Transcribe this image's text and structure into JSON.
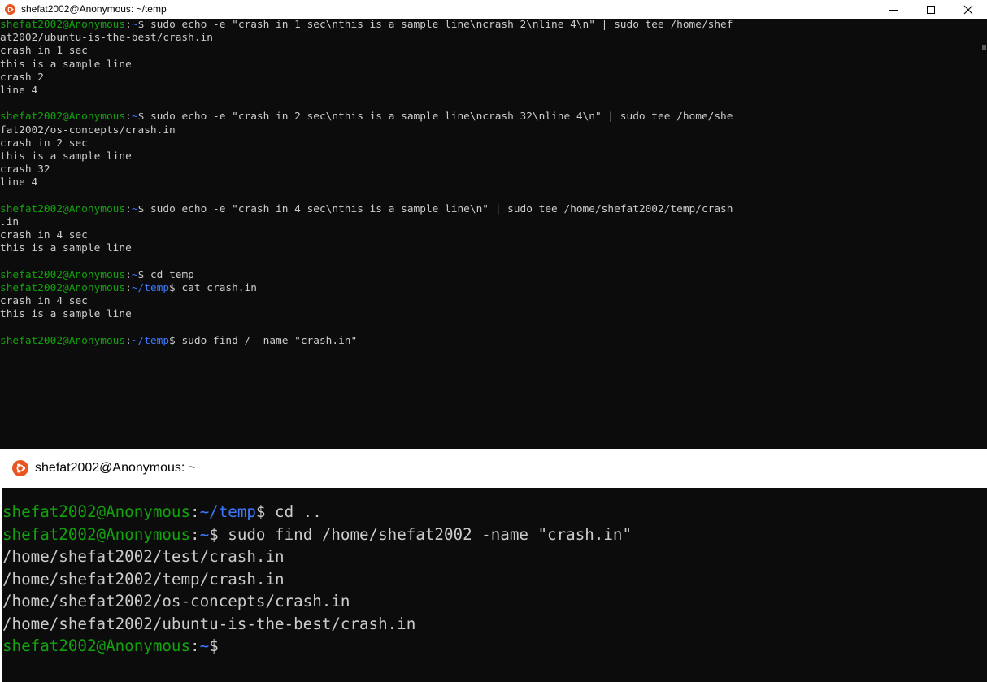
{
  "colors": {
    "background": "#0c0c0c",
    "text": "#cccccc",
    "user": "#13a10e",
    "path": "#3b78ff",
    "ubuntu_orange": "#e95420"
  },
  "window1": {
    "title": "shefat2002@Anonymous: ~/temp",
    "icon": "ubuntu-icon",
    "controls": {
      "minimize": "—",
      "maximize": "☐",
      "close": "✕"
    },
    "lines": [
      {
        "type": "prompt",
        "user": "shefat2002@Anonymous",
        "sep": ":",
        "path": "~",
        "sym": "$ ",
        "cmd": "sudo echo -e \"crash in 1 sec\\nthis is a sample line\\ncrash 2\\nline 4\\n\" | sudo tee /home/shef"
      },
      {
        "type": "output",
        "text": "at2002/ubuntu-is-the-best/crash.in"
      },
      {
        "type": "output",
        "text": "crash in 1 sec"
      },
      {
        "type": "output",
        "text": "this is a sample line"
      },
      {
        "type": "output",
        "text": "crash 2"
      },
      {
        "type": "output",
        "text": "line 4"
      },
      {
        "type": "output",
        "text": ""
      },
      {
        "type": "prompt",
        "user": "shefat2002@Anonymous",
        "sep": ":",
        "path": "~",
        "sym": "$ ",
        "cmd": "sudo echo -e \"crash in 2 sec\\nthis is a sample line\\ncrash 32\\nline 4\\n\" | sudo tee /home/she"
      },
      {
        "type": "output",
        "text": "fat2002/os-concepts/crash.in"
      },
      {
        "type": "output",
        "text": "crash in 2 sec"
      },
      {
        "type": "output",
        "text": "this is a sample line"
      },
      {
        "type": "output",
        "text": "crash 32"
      },
      {
        "type": "output",
        "text": "line 4"
      },
      {
        "type": "output",
        "text": ""
      },
      {
        "type": "prompt",
        "user": "shefat2002@Anonymous",
        "sep": ":",
        "path": "~",
        "sym": "$ ",
        "cmd": "sudo echo -e \"crash in 4 sec\\nthis is a sample line\\n\" | sudo tee /home/shefat2002/temp/crash"
      },
      {
        "type": "output",
        "text": ".in"
      },
      {
        "type": "output",
        "text": "crash in 4 sec"
      },
      {
        "type": "output",
        "text": "this is a sample line"
      },
      {
        "type": "output",
        "text": ""
      },
      {
        "type": "prompt",
        "user": "shefat2002@Anonymous",
        "sep": ":",
        "path": "~",
        "sym": "$ ",
        "cmd": "cd temp"
      },
      {
        "type": "prompt",
        "user": "shefat2002@Anonymous",
        "sep": ":",
        "path": "~/temp",
        "sym": "$ ",
        "cmd": "cat crash.in"
      },
      {
        "type": "output",
        "text": "crash in 4 sec"
      },
      {
        "type": "output",
        "text": "this is a sample line"
      },
      {
        "type": "output",
        "text": ""
      },
      {
        "type": "prompt",
        "user": "shefat2002@Anonymous",
        "sep": ":",
        "path": "~/temp",
        "sym": "$ ",
        "cmd": "sudo find / -name \"crash.in\""
      }
    ]
  },
  "window2": {
    "title": "shefat2002@Anonymous: ~",
    "icon": "ubuntu-icon",
    "lines": [
      {
        "type": "prompt",
        "user": "shefat2002@Anonymous",
        "sep": ":",
        "path": "~/temp",
        "sym": "$ ",
        "cmd": "cd .."
      },
      {
        "type": "prompt",
        "user": "shefat2002@Anonymous",
        "sep": ":",
        "path": "~",
        "sym": "$ ",
        "cmd": "sudo find /home/shefat2002 -name \"crash.in\""
      },
      {
        "type": "output",
        "text": "/home/shefat2002/test/crash.in"
      },
      {
        "type": "output",
        "text": "/home/shefat2002/temp/crash.in"
      },
      {
        "type": "output",
        "text": "/home/shefat2002/os-concepts/crash.in"
      },
      {
        "type": "output",
        "text": "/home/shefat2002/ubuntu-is-the-best/crash.in"
      },
      {
        "type": "prompt",
        "user": "shefat2002@Anonymous",
        "sep": ":",
        "path": "~",
        "sym": "$",
        "cmd": ""
      }
    ]
  }
}
